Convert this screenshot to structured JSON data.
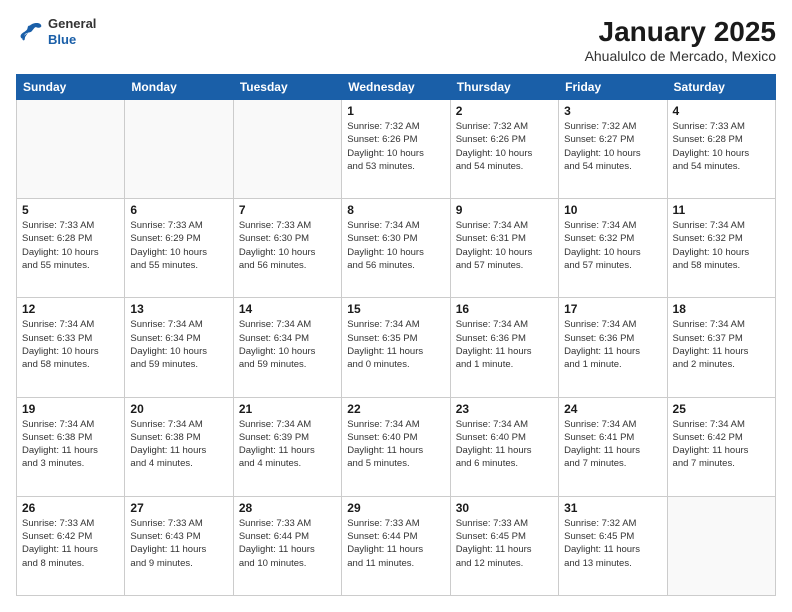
{
  "header": {
    "logo": {
      "general": "General",
      "blue": "Blue"
    },
    "title": "January 2025",
    "subtitle": "Ahualulco de Mercado, Mexico"
  },
  "days_of_week": [
    "Sunday",
    "Monday",
    "Tuesday",
    "Wednesday",
    "Thursday",
    "Friday",
    "Saturday"
  ],
  "weeks": [
    [
      {
        "day": "",
        "info": ""
      },
      {
        "day": "",
        "info": ""
      },
      {
        "day": "",
        "info": ""
      },
      {
        "day": "1",
        "info": "Sunrise: 7:32 AM\nSunset: 6:26 PM\nDaylight: 10 hours\nand 53 minutes."
      },
      {
        "day": "2",
        "info": "Sunrise: 7:32 AM\nSunset: 6:26 PM\nDaylight: 10 hours\nand 54 minutes."
      },
      {
        "day": "3",
        "info": "Sunrise: 7:32 AM\nSunset: 6:27 PM\nDaylight: 10 hours\nand 54 minutes."
      },
      {
        "day": "4",
        "info": "Sunrise: 7:33 AM\nSunset: 6:28 PM\nDaylight: 10 hours\nand 54 minutes."
      }
    ],
    [
      {
        "day": "5",
        "info": "Sunrise: 7:33 AM\nSunset: 6:28 PM\nDaylight: 10 hours\nand 55 minutes."
      },
      {
        "day": "6",
        "info": "Sunrise: 7:33 AM\nSunset: 6:29 PM\nDaylight: 10 hours\nand 55 minutes."
      },
      {
        "day": "7",
        "info": "Sunrise: 7:33 AM\nSunset: 6:30 PM\nDaylight: 10 hours\nand 56 minutes."
      },
      {
        "day": "8",
        "info": "Sunrise: 7:34 AM\nSunset: 6:30 PM\nDaylight: 10 hours\nand 56 minutes."
      },
      {
        "day": "9",
        "info": "Sunrise: 7:34 AM\nSunset: 6:31 PM\nDaylight: 10 hours\nand 57 minutes."
      },
      {
        "day": "10",
        "info": "Sunrise: 7:34 AM\nSunset: 6:32 PM\nDaylight: 10 hours\nand 57 minutes."
      },
      {
        "day": "11",
        "info": "Sunrise: 7:34 AM\nSunset: 6:32 PM\nDaylight: 10 hours\nand 58 minutes."
      }
    ],
    [
      {
        "day": "12",
        "info": "Sunrise: 7:34 AM\nSunset: 6:33 PM\nDaylight: 10 hours\nand 58 minutes."
      },
      {
        "day": "13",
        "info": "Sunrise: 7:34 AM\nSunset: 6:34 PM\nDaylight: 10 hours\nand 59 minutes."
      },
      {
        "day": "14",
        "info": "Sunrise: 7:34 AM\nSunset: 6:34 PM\nDaylight: 10 hours\nand 59 minutes."
      },
      {
        "day": "15",
        "info": "Sunrise: 7:34 AM\nSunset: 6:35 PM\nDaylight: 11 hours\nand 0 minutes."
      },
      {
        "day": "16",
        "info": "Sunrise: 7:34 AM\nSunset: 6:36 PM\nDaylight: 11 hours\nand 1 minute."
      },
      {
        "day": "17",
        "info": "Sunrise: 7:34 AM\nSunset: 6:36 PM\nDaylight: 11 hours\nand 1 minute."
      },
      {
        "day": "18",
        "info": "Sunrise: 7:34 AM\nSunset: 6:37 PM\nDaylight: 11 hours\nand 2 minutes."
      }
    ],
    [
      {
        "day": "19",
        "info": "Sunrise: 7:34 AM\nSunset: 6:38 PM\nDaylight: 11 hours\nand 3 minutes."
      },
      {
        "day": "20",
        "info": "Sunrise: 7:34 AM\nSunset: 6:38 PM\nDaylight: 11 hours\nand 4 minutes."
      },
      {
        "day": "21",
        "info": "Sunrise: 7:34 AM\nSunset: 6:39 PM\nDaylight: 11 hours\nand 4 minutes."
      },
      {
        "day": "22",
        "info": "Sunrise: 7:34 AM\nSunset: 6:40 PM\nDaylight: 11 hours\nand 5 minutes."
      },
      {
        "day": "23",
        "info": "Sunrise: 7:34 AM\nSunset: 6:40 PM\nDaylight: 11 hours\nand 6 minutes."
      },
      {
        "day": "24",
        "info": "Sunrise: 7:34 AM\nSunset: 6:41 PM\nDaylight: 11 hours\nand 7 minutes."
      },
      {
        "day": "25",
        "info": "Sunrise: 7:34 AM\nSunset: 6:42 PM\nDaylight: 11 hours\nand 7 minutes."
      }
    ],
    [
      {
        "day": "26",
        "info": "Sunrise: 7:33 AM\nSunset: 6:42 PM\nDaylight: 11 hours\nand 8 minutes."
      },
      {
        "day": "27",
        "info": "Sunrise: 7:33 AM\nSunset: 6:43 PM\nDaylight: 11 hours\nand 9 minutes."
      },
      {
        "day": "28",
        "info": "Sunrise: 7:33 AM\nSunset: 6:44 PM\nDaylight: 11 hours\nand 10 minutes."
      },
      {
        "day": "29",
        "info": "Sunrise: 7:33 AM\nSunset: 6:44 PM\nDaylight: 11 hours\nand 11 minutes."
      },
      {
        "day": "30",
        "info": "Sunrise: 7:33 AM\nSunset: 6:45 PM\nDaylight: 11 hours\nand 12 minutes."
      },
      {
        "day": "31",
        "info": "Sunrise: 7:32 AM\nSunset: 6:45 PM\nDaylight: 11 hours\nand 13 minutes."
      },
      {
        "day": "",
        "info": ""
      }
    ]
  ]
}
